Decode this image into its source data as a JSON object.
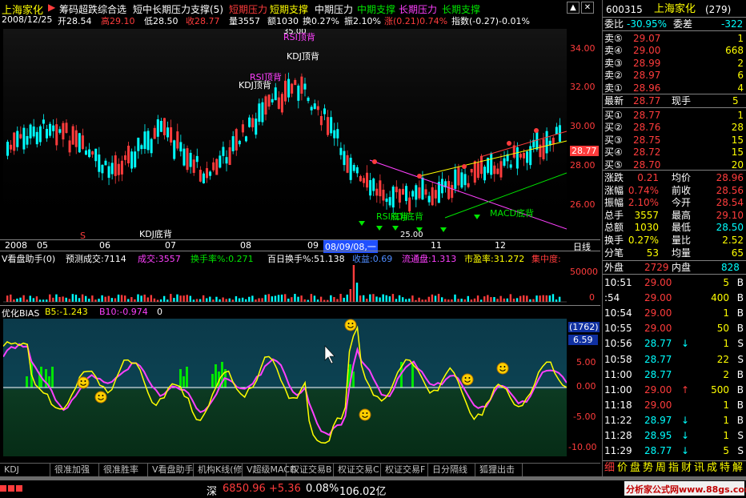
{
  "header": {
    "stock_name": "上海家化",
    "indicator": "筹码超跌综合选",
    "subtitle": "短中长期压力支撑(5)",
    "legend": [
      "短期压力",
      "短期支撑",
      "中期压力",
      "中期支撑",
      "长期压力",
      "长期支撑"
    ]
  },
  "info": {
    "date": "2008/12/25",
    "open": "开28.54",
    "high": "高29.10",
    "low": "低28.50",
    "close": "收28.77",
    "volume": "量3557",
    "amount": "额1030",
    "turnover": "换0.27%",
    "amplitude": "振2.10%",
    "change": "涨(0.21)0.74%",
    "index": "指数(-0.27)-0.01%"
  },
  "price_axis": [
    "34.00",
    "32.00",
    "30.00",
    "28.00",
    "26.00"
  ],
  "current_price_tag": "28.77",
  "date_axis": [
    "2008",
    "05",
    "06",
    "07",
    "08",
    "09",
    "08/09/08,一",
    "11",
    "12",
    "日线"
  ],
  "annotations": {
    "top_price": "35.00",
    "low_price": "25.00",
    "rsi_top_1": "RSI顶背",
    "kdj_top_1": "KDJ顶背",
    "rsi_top_2": "RSI顶背",
    "kdj_top_2": "KDJ顶背",
    "kdj_bottom": "KDJ底背",
    "rsi_bottom": "RSI底背",
    "kdj_bottom_2": "KDJ底背",
    "macd_bottom": "MACD底背",
    "s_marker": "S"
  },
  "vol_bar": {
    "title": "V看盘助手(0)",
    "predict": "预测成交:7114",
    "deal": "成交:3557",
    "turnover": "换手率%:0.271",
    "hundred": "百日换手%:51.138",
    "profit": "收益:0.69",
    "float": "流通盘:1.313",
    "pe": "市盈率:31.272",
    "concentration": "集中度:"
  },
  "vol_axis": [
    "50000",
    "0"
  ],
  "bias_bar": {
    "title": "优化BIAS",
    "b5": "B5:-1.243",
    "b10": "B10:-0.974",
    "zero": "0"
  },
  "bias_axis": [
    "(1762)",
    "6.59",
    "5.00",
    "0.00",
    "-5.00",
    "-10.00"
  ],
  "tabs": [
    "KDJ",
    "很准加强",
    "很准胜率",
    "V看盘助手",
    "机构K线(修",
    "V超级MACD",
    "权证交易B",
    "权证交易C",
    "权证交易F",
    "日分隔线",
    "狐狸出击"
  ],
  "status": {
    "label": "深",
    "value": "6850.96",
    "change": "+5.36",
    "pct": "0.08%",
    "amount": "106.02亿"
  },
  "watermark": "分析家公式网www.88gs.com",
  "panel": {
    "code": "600315",
    "name": "上海家化",
    "count": "(279)",
    "ratio_label": "委比",
    "ratio": "-30.95%",
    "diff_label": "委差",
    "diff": "-322",
    "asks": [
      {
        "label": "卖⑤",
        "price": "29.07",
        "vol": "1"
      },
      {
        "label": "卖④",
        "price": "29.00",
        "vol": "668"
      },
      {
        "label": "卖③",
        "price": "28.99",
        "vol": "2"
      },
      {
        "label": "卖②",
        "price": "28.97",
        "vol": "6"
      },
      {
        "label": "卖①",
        "price": "28.96",
        "vol": "4"
      }
    ],
    "last": {
      "label": "最新",
      "price": "28.77",
      "hand_label": "现手",
      "hand": "5"
    },
    "bids": [
      {
        "label": "买①",
        "price": "28.77",
        "vol": "1"
      },
      {
        "label": "买②",
        "price": "28.76",
        "vol": "28"
      },
      {
        "label": "买③",
        "price": "28.75",
        "vol": "15"
      },
      {
        "label": "买④",
        "price": "28.72",
        "vol": "15"
      },
      {
        "label": "买⑤",
        "price": "28.70",
        "vol": "20"
      }
    ],
    "stats": [
      {
        "l1": "涨跌",
        "v1": "0.21",
        "l2": "均价",
        "v2": "28.96"
      },
      {
        "l1": "涨幅",
        "v1": "0.74%",
        "l2": "前收",
        "v2": "28.56"
      },
      {
        "l1": "振幅",
        "v1": "2.10%",
        "l2": "今开",
        "v2": "28.54"
      },
      {
        "l1": "总手",
        "v1": "3557",
        "l2": "最高",
        "v2": "29.10"
      },
      {
        "l1": "总额",
        "v1": "1030",
        "l2": "最低",
        "v2": "28.50"
      },
      {
        "l1": "换手",
        "v1": "0.27%",
        "l2": "量比",
        "v2": "2.52"
      },
      {
        "l1": "分笔",
        "v1": "53",
        "l2": "均量",
        "v2": "65"
      }
    ],
    "outer": {
      "label": "外盘",
      "value": "2729",
      "inner_label": "内盘",
      "inner": "828"
    },
    "ticks": [
      {
        "time": "10:51",
        "price": "29.00",
        "vol": "5",
        "bs": "B",
        "arrow": ""
      },
      {
        "time": ":54",
        "price": "29.00",
        "vol": "400",
        "bs": "B",
        "arrow": ""
      },
      {
        "time": "10:54",
        "price": "29.00",
        "vol": "1",
        "bs": "B",
        "arrow": ""
      },
      {
        "time": "10:55",
        "price": "29.00",
        "vol": "50",
        "bs": "B",
        "arrow": ""
      },
      {
        "time": "10:56",
        "price": "28.77",
        "vol": "1",
        "bs": "S",
        "arrow": "↓"
      },
      {
        "time": "10:58",
        "price": "28.77",
        "vol": "22",
        "bs": "S",
        "arrow": ""
      },
      {
        "time": "11:00",
        "price": "28.77",
        "vol": "2",
        "bs": "B",
        "arrow": ""
      },
      {
        "time": "11:00",
        "price": "29.00",
        "vol": "500",
        "bs": "B",
        "arrow": "↑"
      },
      {
        "time": "11:18",
        "price": "29.00",
        "vol": "1",
        "bs": "B",
        "arrow": ""
      },
      {
        "time": "11:22",
        "price": "28.97",
        "vol": "1",
        "bs": "B",
        "arrow": "↓"
      },
      {
        "time": "11:28",
        "price": "28.95",
        "vol": "1",
        "bs": "S",
        "arrow": "↓"
      },
      {
        "time": "11:29",
        "price": "28.77",
        "vol": "5",
        "bs": "S",
        "arrow": "↓"
      }
    ],
    "bottom_tabs": [
      "细",
      "价",
      "盘",
      "势",
      "周",
      "指",
      "财",
      "讯",
      "成",
      "特",
      "解"
    ]
  }
}
